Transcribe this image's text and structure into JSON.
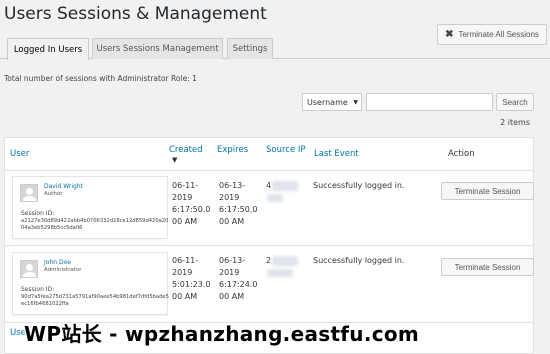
{
  "page": {
    "title": "Users Sessions & Management"
  },
  "toolbar": {
    "terminate_all_label": "Terminate All Sessions"
  },
  "tabs": [
    {
      "label": "Logged In Users",
      "active": true
    },
    {
      "label": "Users Sessions Management",
      "active": false
    },
    {
      "label": "Settings",
      "active": false
    }
  ],
  "summary": {
    "total_text": "Total number of sessions with Administrator Role: 1"
  },
  "search": {
    "select_value": "Username",
    "input_value": "",
    "button_label": "Search"
  },
  "items_count": "2 items",
  "table": {
    "columns": [
      "User",
      "Created",
      "Expires",
      "Source IP",
      "Last Event",
      "Action"
    ],
    "rows": [
      {
        "user_name": "David Wright",
        "user_role": "Author",
        "session_label": "Session ID:",
        "session_id": "a2127e30d89d422abb4b0706332d28ce12d859d420a2004a3eb5298b5cc5da06",
        "created_date": "06-11-",
        "created_year": "2019",
        "created_time": "6:17:50.0",
        "created_ampm": "00 AM",
        "expires_date": "06-13-",
        "expires_year": "2019",
        "expires_time": "6:17:50.0",
        "expires_ampm": "00 AM",
        "ip_prefix": "4",
        "last_event": "Successfully logged in.",
        "action_label": "Terminate Session"
      },
      {
        "user_name": "John Doe",
        "user_role": "Administrator",
        "session_label": "Session ID:",
        "session_id": "90d7a5fea275d731a5791af90aee54b981def7dfd5bade5ec16fb4681022ffa",
        "created_date": "06-11-",
        "created_year": "2019",
        "created_time": "5:01:23.0",
        "created_ampm": "00 AM",
        "expires_date": "06-13-",
        "expires_year": "2019",
        "expires_time": "6:17:24.0",
        "expires_ampm": "00 AM",
        "ip_prefix": "2",
        "last_event": "Successfully logged in.",
        "action_label": "Terminate Session"
      }
    ],
    "footer_user": "User"
  },
  "watermark": {
    "text": "WP站长 - wpzhanzhang.eastfu.com"
  },
  "colors": {
    "link": "#0073aa",
    "background": "#f1f1f1",
    "text": "#23282d"
  }
}
